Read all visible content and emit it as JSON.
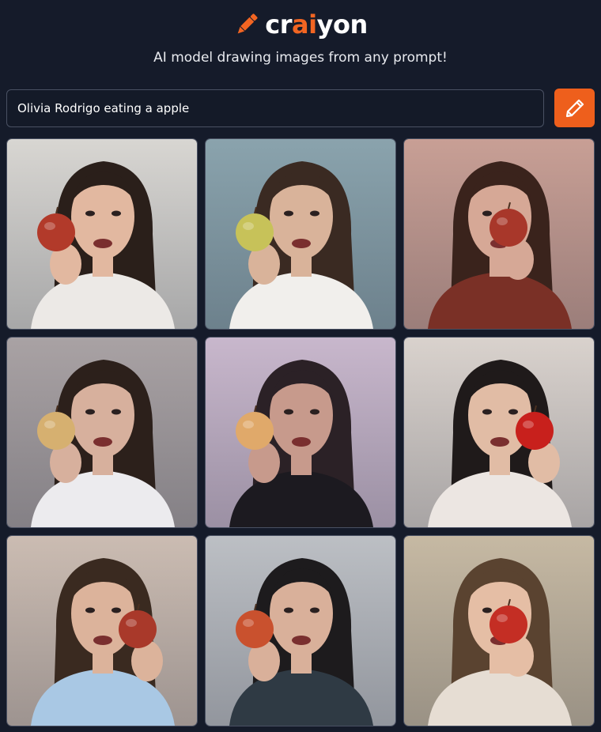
{
  "brand": {
    "name_prefix": "cr",
    "name_accent": "ai",
    "name_suffix": "yon",
    "logo_icon": "pencil-logo-icon",
    "accent_color": "#f26522"
  },
  "tagline": "AI model drawing images from any prompt!",
  "prompt": {
    "value": "Olivia Rodrigo eating a apple",
    "button_icon": "pencil-icon",
    "button_color": "#ee5f1c"
  },
  "results": {
    "count": 9,
    "images": [
      {
        "bg": "#d8d6d2",
        "hair": "#2a1f1a",
        "skin": "#e2b8a0",
        "shirt": "#ece9e6",
        "apple": "#b23a2a",
        "apple_side": "left"
      },
      {
        "bg": "#8aa3ad",
        "hair": "#3a2a22",
        "skin": "#d9b39a",
        "shirt": "#f1efec",
        "apple": "#c7c259",
        "apple_side": "left"
      },
      {
        "bg": "#c89f95",
        "hair": "#3a231c",
        "skin": "#d6a896",
        "shirt": "#7a3026",
        "apple": "#a8372a",
        "apple_side": "center"
      },
      {
        "bg": "#a9a2a4",
        "hair": "#2c201b",
        "skin": "#d7b09d",
        "shirt": "#ecebee",
        "apple": "#d6b070",
        "apple_side": "left"
      },
      {
        "bg": "#c8b7cc",
        "hair": "#2b2126",
        "skin": "#c79a8c",
        "shirt": "#1c1a20",
        "apple": "#e0a96a",
        "apple_side": "left"
      },
      {
        "bg": "#d9d2cd",
        "hair": "#1f1a1a",
        "skin": "#e1bca5",
        "shirt": "#ece6e2",
        "apple": "#c8201c",
        "apple_side": "right"
      },
      {
        "bg": "#cbbcb2",
        "hair": "#3a2a20",
        "skin": "#dcb39b",
        "shirt": "#a9c8e4",
        "apple": "#a9392a",
        "apple_side": "right"
      },
      {
        "bg": "#bcbfc4",
        "hair": "#1d1b1d",
        "skin": "#d9b09a",
        "shirt": "#2f3a44",
        "apple": "#c9512e",
        "apple_side": "left"
      },
      {
        "bg": "#c6b9a3",
        "hair": "#5a4330",
        "skin": "#e5bea5",
        "shirt": "#e6ddd3",
        "apple": "#c42e24",
        "apple_side": "center"
      }
    ]
  }
}
